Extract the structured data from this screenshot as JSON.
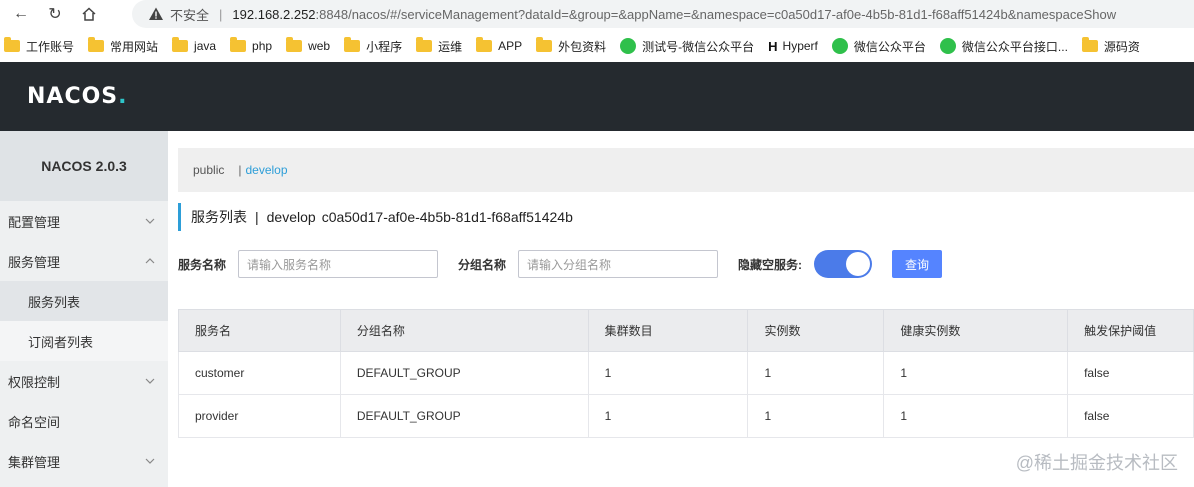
{
  "browser": {
    "security_label": "不安全",
    "url_host": "192.168.2.252",
    "url_rest": ":8848/nacos/#/serviceManagement?dataId=&group=&appName=&namespace=c0a50d17-af0e-4b5b-81d1-f68aff51424b&namespaceShow",
    "bookmarks": [
      "工作账号",
      "常用网站",
      "java",
      "php",
      "web",
      "小程序",
      "运维",
      "APP",
      "外包资料",
      "测试号-微信公众平台",
      "Hyperf",
      "微信公众平台",
      "微信公众平台接口...",
      "源码资"
    ]
  },
  "header": {
    "logo_text": "NACOS",
    "logo_dot": "."
  },
  "sidebar": {
    "version": "NACOS 2.0.3",
    "items": [
      {
        "label": "配置管理"
      },
      {
        "label": "服务管理"
      },
      {
        "label": "服务列表"
      },
      {
        "label": "订阅者列表"
      },
      {
        "label": "权限控制"
      },
      {
        "label": "命名空间"
      },
      {
        "label": "集群管理"
      }
    ]
  },
  "namespaces": {
    "public": "public",
    "separator": "|",
    "develop": "develop"
  },
  "title": {
    "text": "服务列表",
    "separator": "|",
    "namespace": "develop",
    "namespace_id": "c0a50d17-af0e-4b5b-81d1-f68aff51424b"
  },
  "filters": {
    "service_label": "服务名称",
    "service_placeholder": "请输入服务名称",
    "group_label": "分组名称",
    "group_placeholder": "请输入分组名称",
    "hide_empty_label": "隐藏空服务:",
    "query_label": "查询"
  },
  "table": {
    "headers": [
      "服务名",
      "分组名称",
      "集群数目",
      "实例数",
      "健康实例数",
      "触发保护阈值"
    ],
    "rows": [
      [
        "customer",
        "DEFAULT_GROUP",
        "1",
        "1",
        "1",
        "false"
      ],
      [
        "provider",
        "DEFAULT_GROUP",
        "1",
        "1",
        "1",
        "false"
      ]
    ]
  },
  "watermark": "@稀土掘金技术社区",
  "colors": {
    "accent": "#2d9ed8",
    "primary_button": "#5584ff",
    "toggle_on": "#4b7be9",
    "header_bg": "#252a2f"
  }
}
